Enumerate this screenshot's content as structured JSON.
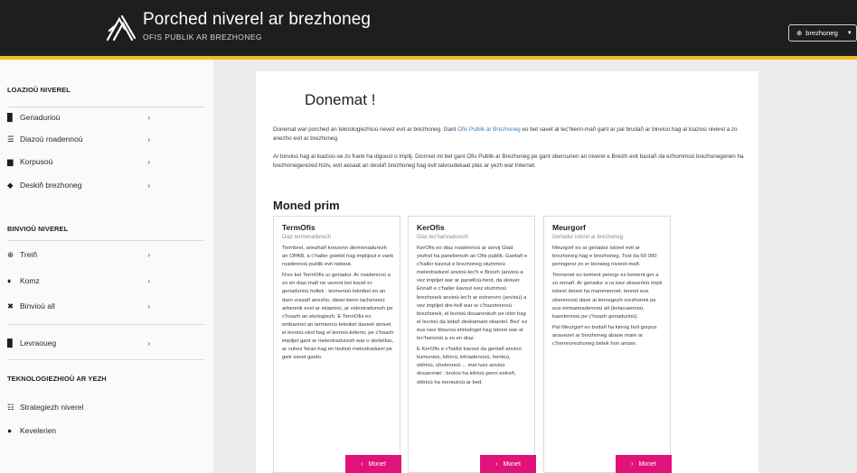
{
  "header": {
    "title": "Porched niverel ar brezhoneg",
    "subtitle": "OFIS PUBLIK AR BREZHONEG",
    "lang_icon": "globe-icon",
    "lang_label": "brezhoneg",
    "accent_color": "#f3bd1a"
  },
  "sidebar": {
    "section1": "LOAZIOÙ NIVEREL",
    "section1_items": [
      {
        "label": "Geriadurioù",
        "icon": "book-icon"
      },
      {
        "label": "Diazoù roadennoù",
        "icon": "database-icon"
      },
      {
        "label": "Korpusoù",
        "icon": "folder-icon"
      },
      {
        "label": "Deskiñ brezhoneg",
        "icon": "graduation-cap-icon"
      }
    ],
    "section2": "BINVIOÙ NIVEREL",
    "section2_items": [
      {
        "label": "Treiñ",
        "icon": "globe-icon"
      },
      {
        "label": "Komz",
        "icon": "microphone-icon"
      },
      {
        "label": "Binvioù all",
        "icon": "tools-icon"
      }
    ],
    "section3_items": [
      {
        "label": "Levraoueg",
        "icon": "book-icon"
      }
    ],
    "section4": "TEKNOLOGIEZHIOÙ AR YEZH",
    "section4_items": [
      {
        "label": "Strategiezh niverel",
        "icon": "list-icon"
      },
      {
        "label": "Kevelerien",
        "icon": "people-icon"
      }
    ]
  },
  "main": {
    "welcome": "Donemat !",
    "intro_p1_before": "Donemat war porched an teknologiezhioù nevez evit ar brezhoneg. Gant ",
    "intro_link": "Ofis Publik ar Brezhoneg",
    "intro_p1_after": " eo bet savet al lec'hienn-mañ gant ar pal brudañ ar binvioù hag al loazioù niverel a zo anezho evit ar brezhoneg.",
    "intro_p2": "Ar binvioù hag al loazioù-se zo frank ha digoust o implij. Diorroet int bet gant Ofis Publik ar Brezhoneg pe gant oberourien an niverel e Breizh evit bastañ da ezhommoù brezhonegerien ha brezhonegerezed hiziv, evit aesaat an deskiñ brezhoneg hag evit talvoudekaat plas ar yezh war Internet.",
    "section_title": "Moned prim",
    "cards": [
      {
        "title": "TermOfis",
        "subtitle": "Diaz termenadurezh",
        "p1": "Termbret, anezhañ kreizenn dermenadurezh an OPAB, a c'haller gwelet hag implijout e vank roadennoù publik evit nebeut.",
        "p2": "N'eo ket TermOfis ur geriadur. Ar roadennoù a zo en diaz-mañ ne vezont ket kavet er geriadurioù hollek : termenoù teknikel eo an darn vrasañ anezho, diwar-benn tachennoù arbennik evel ar skiantoù, ar velestradurezh pe c'hoazh an ekologiezh. E TermOfis eo embannet an termenoù teknikel daveet skrivet el levrioù-skol hag el levrioù-kelenn, pe c'hoazh implijet gant ar melestradurezh war o skritelloù, ar vuhez foran hag en teulioù melestradurel pe gwir savet ganto.",
        "button": "Monet"
      },
      {
        "title": "KerOfis",
        "subtitle": "Diaz lec'hanvadurezh",
        "p1": "KerOfis eo diaz roadennoù ar servij Glad yezhel ha panellerezh an Ofis publik. Gantañ e c'haller kavout e brezhoneg stummoù melestradurel anvioù-lec'h e Breizh (anvioù a vez implijet war ar panelloù-hent, da skouer. Ennañ e c'haller kavout ivez stummoù brezhonek anvioù-lec'h ar estrenvro (anvioù) a vez implijet dre-holl war ar c'hazetennoù brezhonek, el levrioù douaroniezh pe istor hag el levrioù da ledañ deskamant skiantel. Bez' ez eus ivez titouroù etimologel hag istorel war al lec'hanvioù a zo en diaz.",
        "p2": "E KerOfis e c'hallot kavout da gentañ anvioù kumunioù, kêrioù, kêriadennoù, hentoù, stêrioù, uhelennoù ... met ivez anvioù douaroniel : broioù ha kêrioù-penn estreñ, stêrioù ha menezioù ar bed.",
        "button": "Monet"
      },
      {
        "title": "Meurgorf",
        "subtitle": "Geriadur istorel ar brezhoneg",
        "p1": "Meurgorf eo ar geriadur istorel evit ar brezhoneg hag e brezhoneg. Tost da 60 000 penngersr zo er bonweg niverel-mañ.",
        "p2": "Termenet eo kement penngr ez kement ger a zo ennañ. Ar geriadur a ra ivez skouerioù impli istorel deizet ha mammennet, tennet eus oberennoù dave al lennegezh vrezhonek pe eus embannadennoù all (kelaouennoù, kazetennoù pe c'hoazh geriadurioù).",
        "p3": "Pal Meurgorf eo bodañ ha kinnig holl gorpus anavezet ar brezhoneg abaoe mare ar c'hrennvrezhoneg betek hon amzer.",
        "button": "Monet"
      }
    ]
  }
}
